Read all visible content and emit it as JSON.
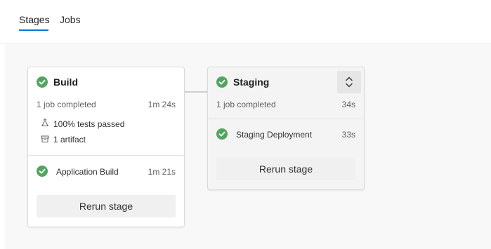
{
  "tabs": [
    {
      "label": "Stages",
      "active": true
    },
    {
      "label": "Jobs",
      "active": false
    }
  ],
  "colors": {
    "accent": "#0078d4",
    "success": "#55a362"
  },
  "stages": [
    {
      "name": "Build",
      "status_icon": "check-circle-icon",
      "summary": "1 job completed",
      "duration": "1m 24s",
      "details": [
        {
          "icon": "flask-icon",
          "text": "100% tests passed"
        },
        {
          "icon": "artifact-icon",
          "text": "1 artifact"
        }
      ],
      "jobs": [
        {
          "name": "Application Build",
          "duration": "1m 21s",
          "status_icon": "check-circle-icon"
        }
      ],
      "rerun_label": "Rerun stage"
    },
    {
      "name": "Staging",
      "status_icon": "check-circle-icon",
      "summary": "1 job completed",
      "duration": "34s",
      "expand_icon": "expand-collapse-icon",
      "jobs": [
        {
          "name": "Staging Deployment",
          "duration": "33s",
          "status_icon": "check-circle-icon"
        }
      ],
      "rerun_label": "Rerun stage"
    }
  ]
}
